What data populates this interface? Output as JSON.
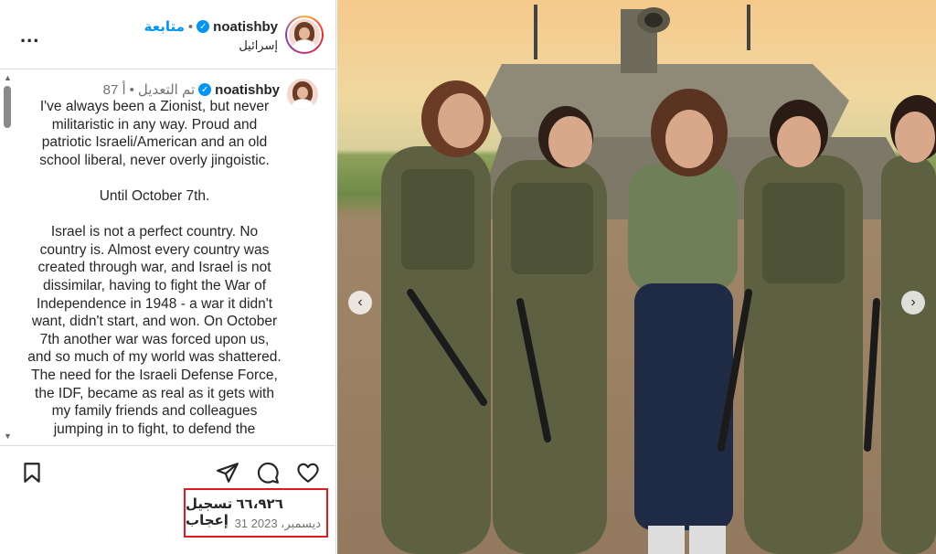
{
  "header": {
    "username": "noatishby",
    "follow_label": "متابعة",
    "separator": "•",
    "location": "إسرائيل",
    "more_label": "..."
  },
  "caption": {
    "username": "noatishby",
    "edited_label": "تم التعديل",
    "separator": "•",
    "age": "87 أ",
    "text": "I've always been a Zionist, but never militaristic in any way. Proud and patriotic Israeli/American and an old school liberal, never overly jingoistic.\n\nUntil October 7th.\n\nIsrael is not a perfect country. No country is. Almost every country was created through war, and Israel is not dissimilar, having to fight the War of Independence in 1948 - a war it didn't want, didn't start, and won. On October 7th another war was forced upon us, and so much of my world was shattered. The need for the Israeli Defense Force, the IDF, became as real as it gets with my family friends and colleagues jumping in to fight, to defend the"
  },
  "stats": {
    "likes": "٦٦،٩٢٦ تسجيل إعجاب",
    "date": "31 ديسمبر، 2023"
  },
  "icons": {
    "more": "more-options-icon",
    "like": "heart-icon",
    "comment": "comment-icon",
    "share": "share-icon",
    "save": "bookmark-icon",
    "verified": "verified-badge-icon",
    "prev": "chevron-left-icon",
    "next": "chevron-right-icon"
  },
  "colors": {
    "accent": "#0095f6",
    "highlight_box": "#e0191f",
    "muted": "#737373"
  }
}
